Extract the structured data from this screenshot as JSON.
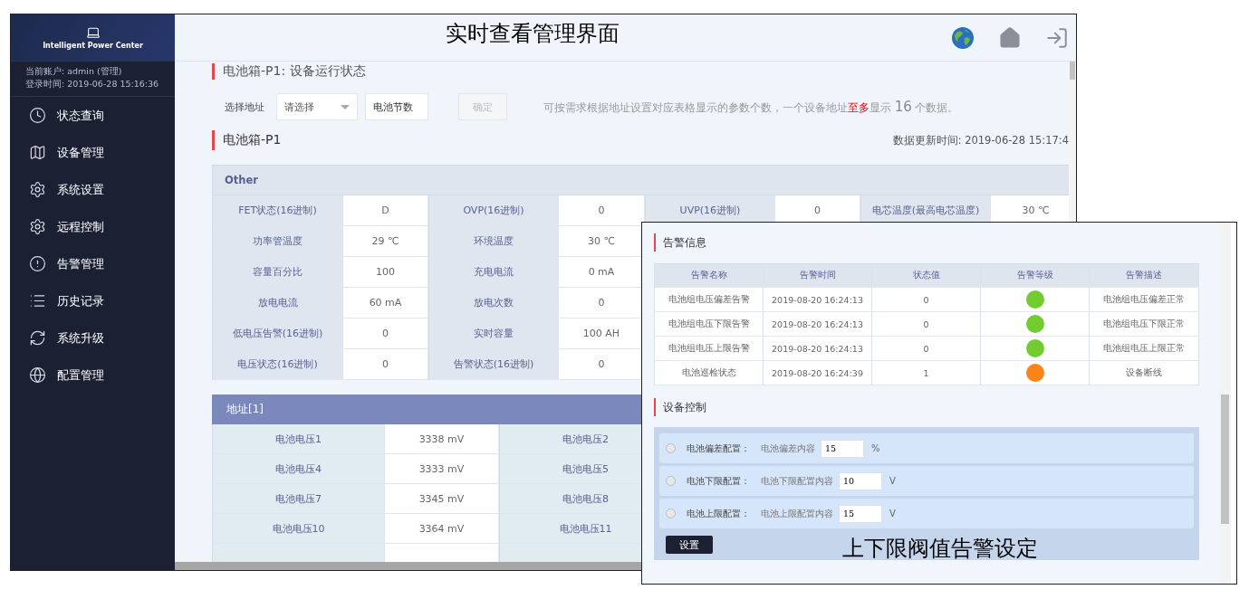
{
  "main_window": {
    "caption": "实时查看管理界面",
    "sidebar": {
      "brand": "Intelligent Power Center",
      "account": "当前账户: admin (管理)",
      "login_time": "登录时间: 2019-06-28 15:16:36",
      "items": [
        {
          "label": "状态查询"
        },
        {
          "label": "设备管理"
        },
        {
          "label": "系统设置"
        },
        {
          "label": "远程控制"
        },
        {
          "label": "告警管理"
        },
        {
          "label": "历史记录"
        },
        {
          "label": "系统升级"
        },
        {
          "label": "配置管理"
        }
      ]
    },
    "section_title": "电池箱-P1: 设备运行状态",
    "toolbar": {
      "address_label": "选择地址",
      "select_value": "请选择",
      "count_placeholder": "电池节数",
      "confirm": {
        "label": "确定",
        "disabled": true
      },
      "hint": {
        "before": "可按需求根据地址设置对应表格显示的参数个数，一个设备地址",
        "emphasis": "至多",
        "middle": "显示 ",
        "count": "16",
        "after": " 个数据。"
      }
    },
    "box_title": "电池箱-P1",
    "update_time": "数据更新时间: 2019-06-28 15:17:4",
    "other_table": {
      "title": "Other",
      "rows": [
        [
          "FET状态(16进制)",
          "D",
          "OVP(16进制)",
          "0",
          "UVP(16进制)",
          "0",
          "电芯温度(最高电芯温度)",
          "30 ℃"
        ],
        [
          "功率管温度",
          "29 ℃",
          "环境温度",
          "30 ℃"
        ],
        [
          "容量百分比",
          "100",
          "充电电流",
          "0 mA"
        ],
        [
          "放电电流",
          "60 mA",
          "放电次数",
          "0"
        ],
        [
          "低电压告警(16进制)",
          "0",
          "实时容量",
          "100 AH"
        ],
        [
          "电压状态(16进制)",
          "0",
          "告警状态(16进制)",
          "0"
        ]
      ]
    },
    "address_table": {
      "title": "地址[1]",
      "rows": [
        [
          "电池电压1",
          "3338 mV",
          "电池电压2"
        ],
        [
          "电池电压4",
          "3333 mV",
          "电池电压5"
        ],
        [
          "电池电压7",
          "3345 mV",
          "电池电压8"
        ],
        [
          "电池电压10",
          "3364 mV",
          "电池电压11"
        ]
      ]
    }
  },
  "popup_window": {
    "caption": "上下限阀值告警设定",
    "alarm_title": "告警信息",
    "alarm_table": {
      "columns": [
        "告警名称",
        "告警时间",
        "状态值",
        "告警等级",
        "告警描述"
      ],
      "rows": [
        {
          "name": "电池组电压偏差告警",
          "time": "2019-08-20 16:24:13",
          "value": "0",
          "color": "#72cc2f",
          "description": "电池组电压偏差正常"
        },
        {
          "name": "电池组电压下限告警",
          "time": "2019-08-20 16:24:13",
          "value": "0",
          "color": "#72cc2f",
          "description": "电池组电压下限正常"
        },
        {
          "name": "电池组电压上限告警",
          "time": "2019-08-20 16:24:13",
          "value": "0",
          "color": "#72cc2f",
          "description": "电池组电压上限正常"
        },
        {
          "name": "电池巡检状态",
          "time": "2019-08-20 16:24:39",
          "value": "1",
          "color": "#fb8419",
          "description": "设备断线"
        }
      ]
    },
    "control_title": "设备控制",
    "controls": [
      {
        "checked": false,
        "label": "电池偏差配置：",
        "field_label": "电池偏差内容",
        "value": "15",
        "unit": "%"
      },
      {
        "checked": false,
        "label": "电池下限配置：",
        "field_label": "电池下限配置内容",
        "value": "10",
        "unit": "V"
      },
      {
        "checked": false,
        "label": "电池上限配置：",
        "field_label": "电池上限配置内容",
        "value": "15",
        "unit": "V"
      }
    ],
    "set_button": "设置"
  }
}
